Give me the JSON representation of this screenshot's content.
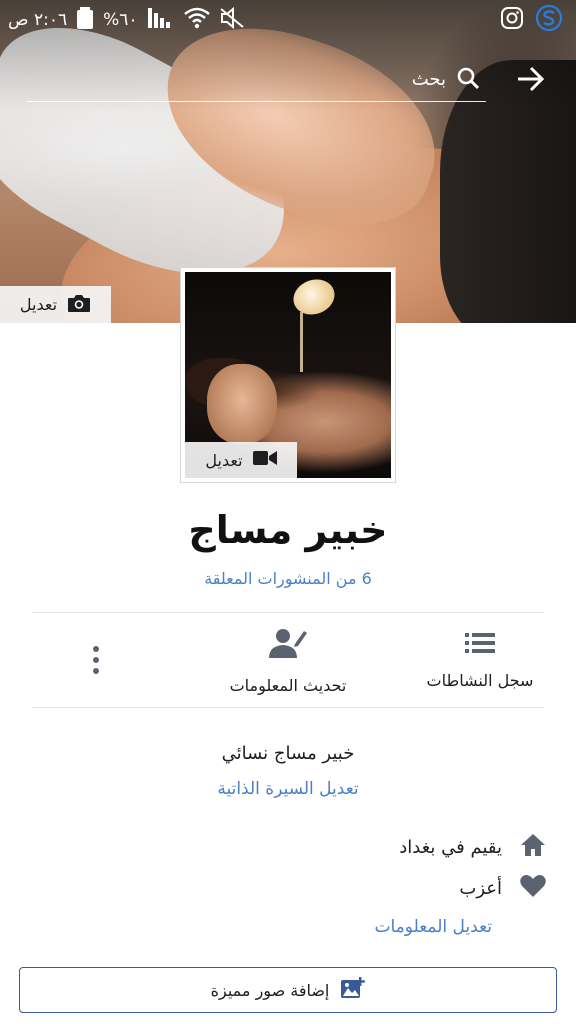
{
  "status_bar": {
    "time": "٢:٠٦ ص",
    "battery": "%٦٠",
    "icons": [
      "signal-icon",
      "wifi-icon",
      "mute-icon",
      "instagram-icon",
      "app-s-icon"
    ]
  },
  "search": {
    "placeholder": "بحث",
    "icon": "search-icon",
    "back_icon": "arrow-icon"
  },
  "cover": {
    "edit_label": "تعديل",
    "edit_icon": "camera-icon"
  },
  "avatar": {
    "edit_label": "تعديل",
    "edit_icon": "video-camera-icon"
  },
  "profile": {
    "name": "خبير مساج",
    "pinned_posts": "6 من المنشورات المعلقة"
  },
  "actions": {
    "activity_log": "سجل النشاطات",
    "update_info": "تحديث المعلومات",
    "more_icon": "more-vertical-icon"
  },
  "bio": {
    "text": "خبير مساج نسائي",
    "edit_label": "تعديل السيرة الذاتية"
  },
  "details": {
    "lives_in": "يقيم في بغداد",
    "relationship": "أعزب",
    "edit_info": "تعديل المعلومات"
  },
  "featured": {
    "label": "إضافة صور مميزة",
    "icon": "add-photo-icon"
  },
  "colors": {
    "link": "#4a80c8",
    "icon_gray": "#5c6370",
    "button_border": "#3b5998"
  }
}
